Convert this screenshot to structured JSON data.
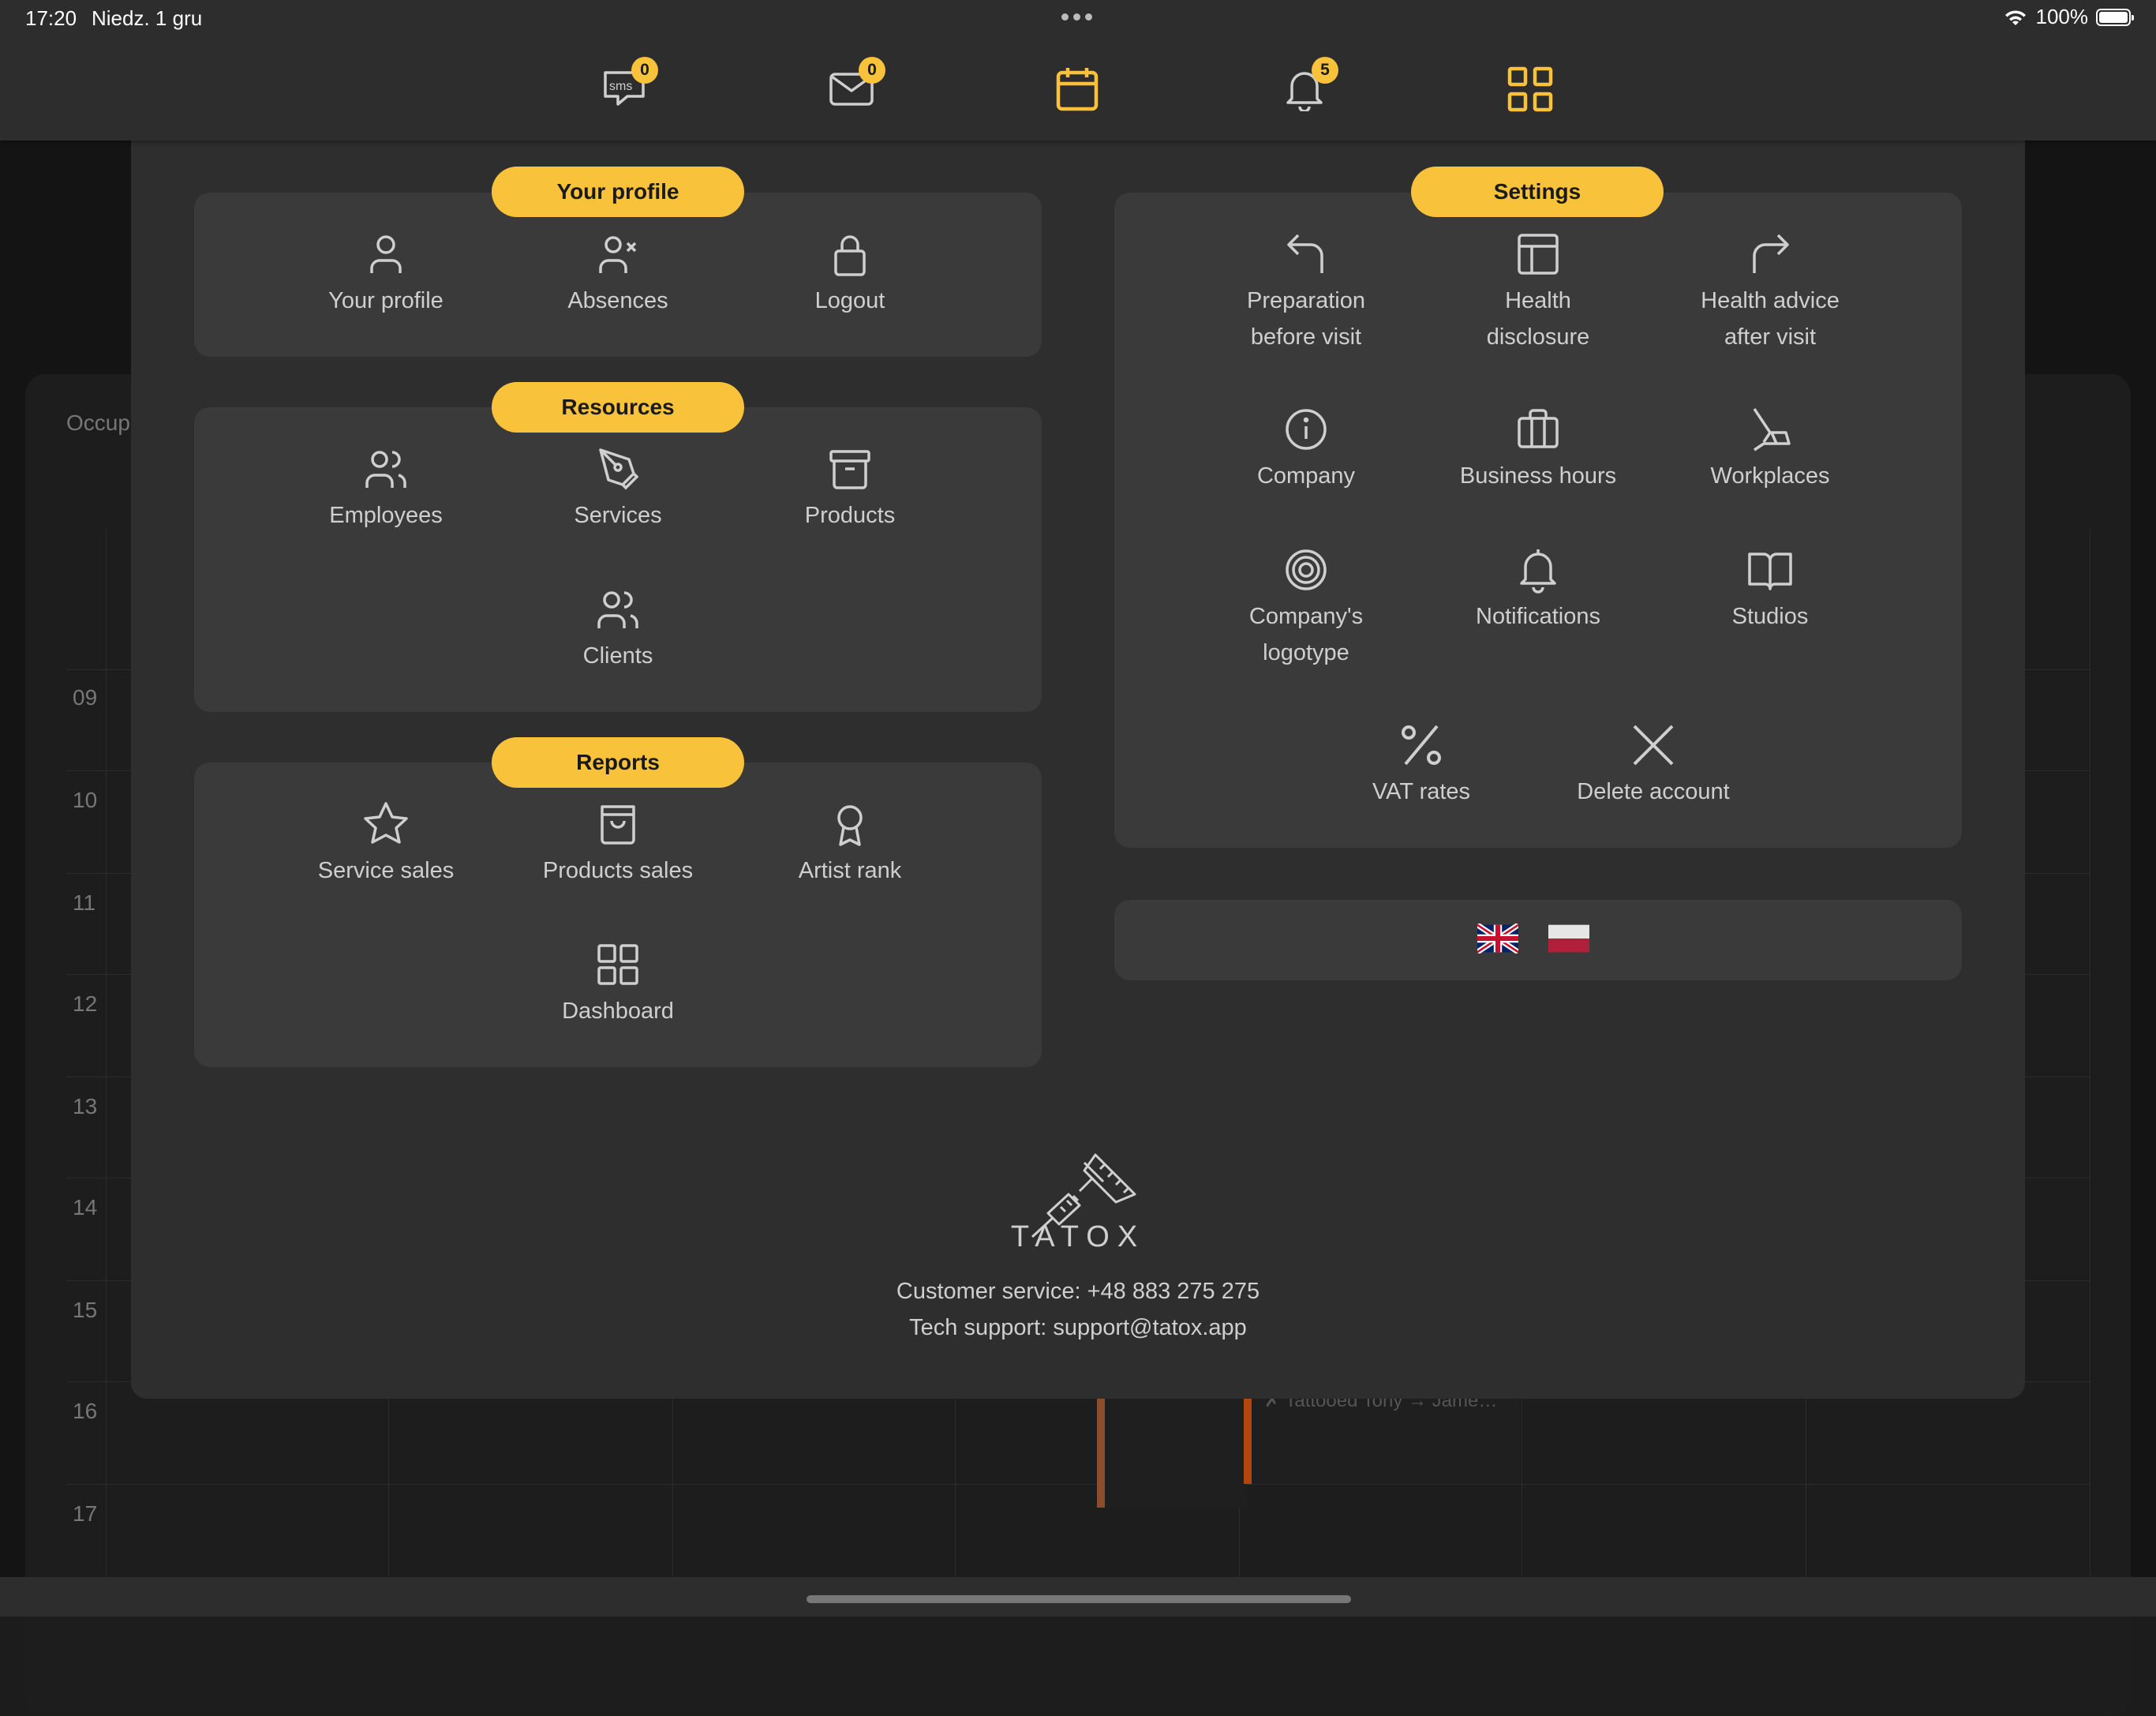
{
  "status_bar": {
    "time": "17:20",
    "date": "Niedz. 1 gru",
    "battery": "100%"
  },
  "top_nav": {
    "sms_badge": "0",
    "mail_badge": "0",
    "notifications_badge": "5",
    "icons": [
      "sms-icon",
      "mail-icon",
      "calendar-icon",
      "bell-icon",
      "grid-icon"
    ],
    "active_color": "#f8c23a"
  },
  "background": {
    "occupancy_label": "Occup",
    "hours": [
      "09",
      "10",
      "11",
      "12",
      "13",
      "14",
      "15",
      "16",
      "17"
    ],
    "event_text": "✗ Tattooed Tony → Jame…"
  },
  "menu": {
    "profile": {
      "title": "Your profile",
      "items": [
        "Your profile",
        "Absences",
        "Logout"
      ]
    },
    "resources": {
      "title": "Resources",
      "items": [
        "Employees",
        "Services",
        "Products",
        "Clients"
      ]
    },
    "reports": {
      "title": "Reports",
      "items": [
        "Service sales",
        "Products sales",
        "Artist rank",
        "Dashboard"
      ]
    },
    "settings": {
      "title": "Settings",
      "items": [
        "Preparation\nbefore visit",
        "Health\ndisclosure",
        "Health advice\nafter visit",
        "Company",
        "Business hours",
        "Workplaces",
        "Company's\nlogotype",
        "Notifications",
        "Studios",
        "VAT rates",
        "Delete account"
      ]
    },
    "languages": [
      "en-flag-icon",
      "pl-flag-icon"
    ]
  },
  "footer": {
    "brand": "TATOX",
    "customer_service": "Customer service: +48 883 275 275",
    "tech_support": "Tech support: support@tatox.app"
  },
  "colors": {
    "accent": "#f8c23a",
    "panel": "#3a3a3a",
    "overlay": "#2e2e2e"
  }
}
